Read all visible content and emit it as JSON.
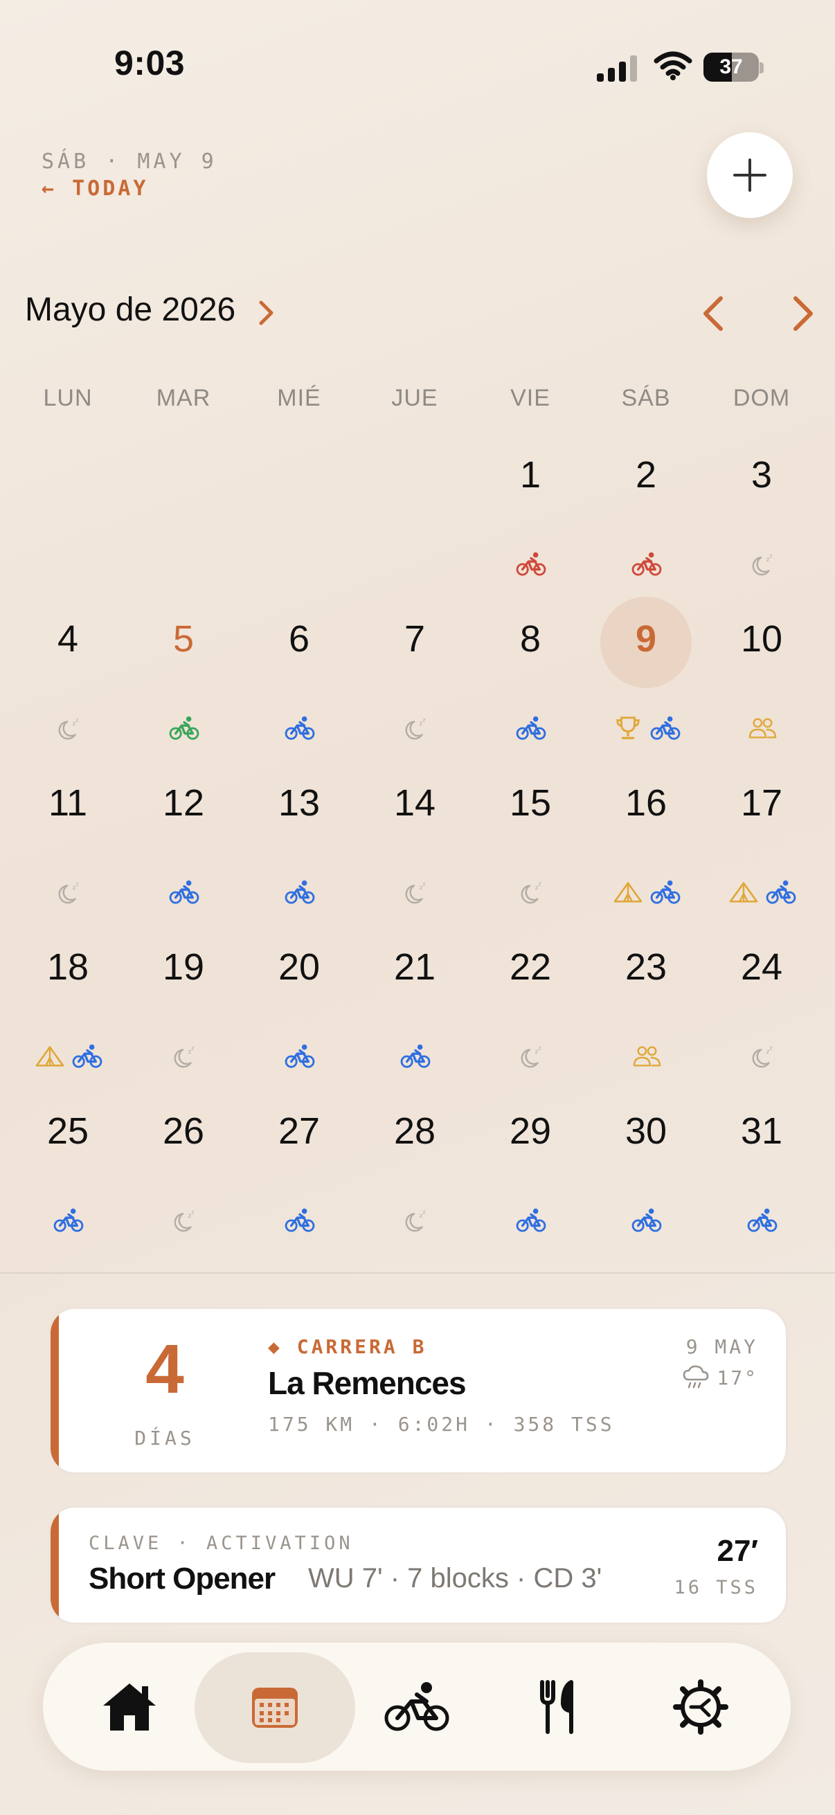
{
  "status_bar": {
    "time": "9:03",
    "battery": "37"
  },
  "header": {
    "date_label": "SÁB · MAY 9",
    "today_link": "← TODAY"
  },
  "calendar": {
    "month_title": "Mayo de 2026",
    "weekdays": [
      "LUN",
      "MAR",
      "MIÉ",
      "JUE",
      "VIE",
      "SÁB",
      "DOM"
    ],
    "weeks": [
      [
        {
          "d": ""
        },
        {
          "d": ""
        },
        {
          "d": ""
        },
        {
          "d": ""
        },
        {
          "d": "1",
          "icons": [
            "bike-red"
          ]
        },
        {
          "d": "2",
          "icons": [
            "bike-red"
          ]
        },
        {
          "d": "3",
          "icons": [
            "rest"
          ]
        }
      ],
      [
        {
          "d": "4",
          "icons": [
            "rest"
          ]
        },
        {
          "d": "5",
          "state": "orange",
          "icons": [
            "bike-green"
          ]
        },
        {
          "d": "6",
          "icons": [
            "bike-blue"
          ]
        },
        {
          "d": "7",
          "icons": [
            "rest"
          ]
        },
        {
          "d": "8",
          "icons": [
            "bike-blue"
          ]
        },
        {
          "d": "9",
          "state": "selected",
          "icons": [
            "trophy",
            "bike-blue"
          ]
        },
        {
          "d": "10",
          "icons": [
            "group"
          ]
        }
      ],
      [
        {
          "d": "11",
          "icons": [
            "rest"
          ]
        },
        {
          "d": "12",
          "icons": [
            "bike-blue"
          ]
        },
        {
          "d": "13",
          "icons": [
            "bike-blue"
          ]
        },
        {
          "d": "14",
          "icons": [
            "rest"
          ]
        },
        {
          "d": "15",
          "icons": [
            "rest"
          ]
        },
        {
          "d": "16",
          "icons": [
            "tent",
            "bike-blue"
          ]
        },
        {
          "d": "17",
          "icons": [
            "tent",
            "bike-blue"
          ]
        }
      ],
      [
        {
          "d": "18",
          "icons": [
            "tent",
            "bike-blue"
          ]
        },
        {
          "d": "19",
          "icons": [
            "rest"
          ]
        },
        {
          "d": "20",
          "icons": [
            "bike-blue"
          ]
        },
        {
          "d": "21",
          "icons": [
            "bike-blue"
          ]
        },
        {
          "d": "22",
          "icons": [
            "rest"
          ]
        },
        {
          "d": "23",
          "icons": [
            "group"
          ]
        },
        {
          "d": "24",
          "icons": [
            "rest"
          ]
        }
      ],
      [
        {
          "d": "25",
          "icons": [
            "bike-blue"
          ]
        },
        {
          "d": "26",
          "icons": [
            "rest"
          ]
        },
        {
          "d": "27",
          "icons": [
            "bike-blue"
          ]
        },
        {
          "d": "28",
          "icons": [
            "rest"
          ]
        },
        {
          "d": "29",
          "icons": [
            "bike-blue"
          ]
        },
        {
          "d": "30",
          "icons": [
            "bike-blue"
          ]
        },
        {
          "d": "31",
          "icons": [
            "bike-blue"
          ]
        }
      ]
    ]
  },
  "race_card": {
    "days_count": "4",
    "days_label": "DÍAS",
    "race_type": "◆ CARRERA B",
    "race_name": "La Remences",
    "race_stats": "175 KM · 6:02H · 358 TSS",
    "race_date": "9 MAY",
    "weather_temp": "17°"
  },
  "workout_card": {
    "tag": "CLAVE · ACTIVATION",
    "name": "Short Opener",
    "detail": "WU 7' · 7 blocks · CD 3'",
    "duration": "27′",
    "tss": "16 TSS"
  },
  "tabs": [
    "home-icon",
    "calendar-icon",
    "bike-icon",
    "fork-knife-icon",
    "settings-icon"
  ],
  "colors": {
    "accent": "#c96a36",
    "bike_blue": "#2f6fe0",
    "bike_red": "#d0483a",
    "bike_green": "#3aa55a",
    "gold": "#e0a83a",
    "rest": "#b3ada6"
  }
}
